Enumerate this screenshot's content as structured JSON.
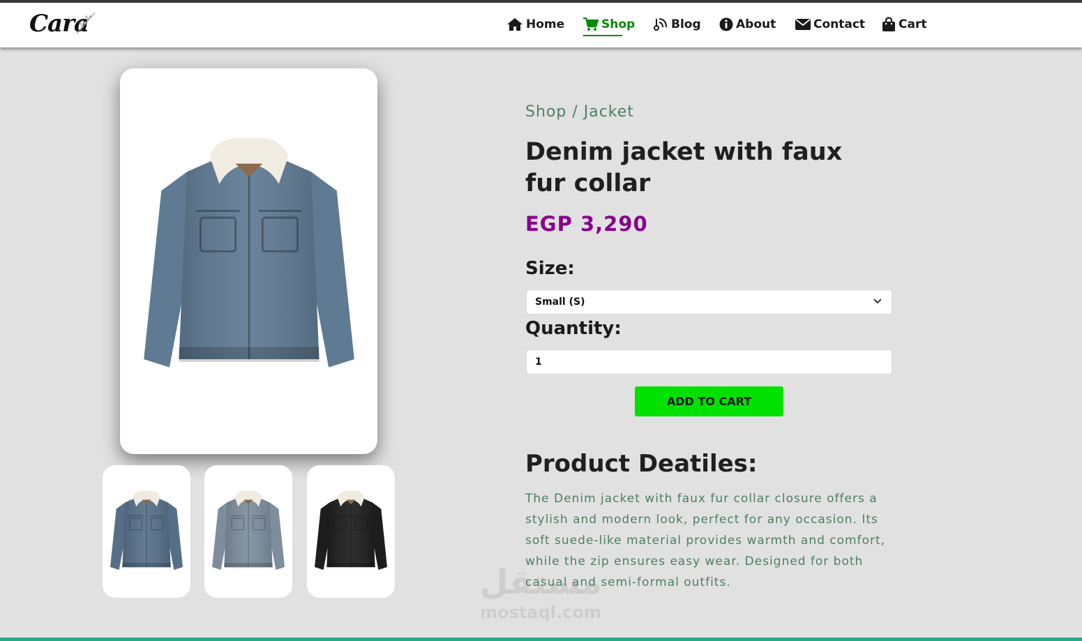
{
  "brand": {
    "logo_text": "Cara"
  },
  "nav": {
    "items": [
      {
        "label": "Home",
        "icon": "home-icon"
      },
      {
        "label": "Shop",
        "icon": "cart-icon",
        "active": true
      },
      {
        "label": "Blog",
        "icon": "blog-icon"
      },
      {
        "label": "About",
        "icon": "info-icon"
      },
      {
        "label": "Contact",
        "icon": "envelope-icon"
      },
      {
        "label": "Cart",
        "icon": "shopping-bag-icon"
      }
    ]
  },
  "product": {
    "breadcrumb": "Shop / Jacket",
    "title": "Denim jacket with faux fur collar",
    "price": "EGP 3,290",
    "size_label": "Size:",
    "size_selected": "Small (S)",
    "quantity_label": "Quantity:",
    "quantity_value": "1",
    "add_to_cart": "ADD TO CART",
    "details_title": "Product Deatiles:",
    "details_text": "The Denim jacket with faux fur collar closure offers a stylish and modern look, perfect for any occasion. Its soft suede-like material provides warmth and comfort, while the zip ensures easy wear. Designed for both casual and semi-formal outfits."
  },
  "gallery": {
    "thumbnails": [
      {
        "variant": "blue-denim"
      },
      {
        "variant": "light-blue-denim"
      },
      {
        "variant": "black-denim"
      }
    ]
  },
  "watermark": {
    "arabic": "مستقل",
    "latin": "mostaql.com"
  },
  "colors": {
    "accent_green": "#088a08",
    "price_purple": "#88008b",
    "button_green": "#00e100",
    "text_green": "#4f7f66"
  }
}
